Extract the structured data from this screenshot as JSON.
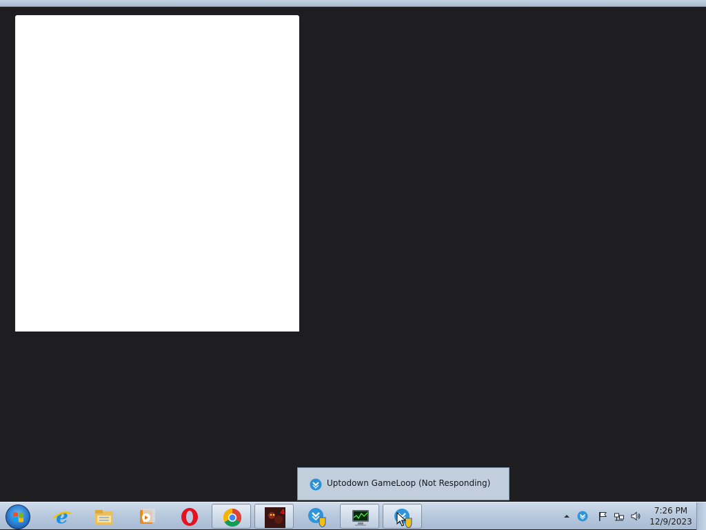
{
  "desktop": {
    "background": "#1e1e21"
  },
  "window": {
    "content_color": "#ffffff"
  },
  "taskbar": {
    "items": [
      {
        "name": "internet-explorer-icon",
        "active": false
      },
      {
        "name": "file-explorer-icon",
        "active": false
      },
      {
        "name": "media-player-icon",
        "active": false
      },
      {
        "name": "opera-icon",
        "active": false
      },
      {
        "name": "chrome-icon",
        "active": true
      },
      {
        "name": "game-app-icon",
        "active": true
      },
      {
        "name": "gameloop-icon",
        "active": false
      },
      {
        "name": "task-manager-icon",
        "active": true
      },
      {
        "name": "gameloop-shield-icon",
        "active": true
      }
    ]
  },
  "thumbnail": {
    "title": "Uptodown GameLoop  (Not Responding)"
  },
  "tray": {
    "icons": [
      "show-hidden-icons-arrow",
      "gameloop-tray-icon",
      "action-center-flag-icon",
      "network-icon",
      "volume-icon"
    ]
  },
  "clock": {
    "time": "7:26 PM",
    "date": "12/9/2023"
  }
}
